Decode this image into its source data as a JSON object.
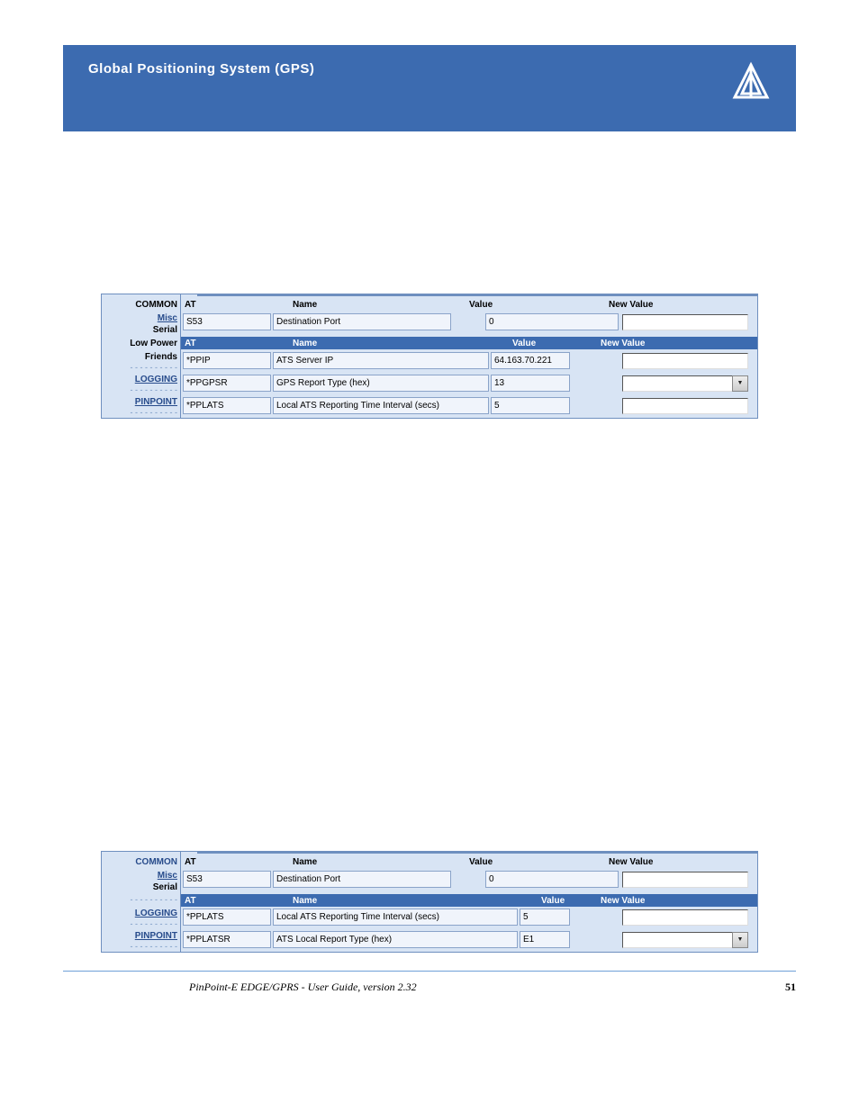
{
  "header": {
    "title": "Global Positioning System (GPS)"
  },
  "figure1": {
    "sidebar": {
      "common": "COMMON",
      "misc": "Misc",
      "serial": "Serial",
      "lowpower": "Low Power",
      "friends": "Friends",
      "logging": "LOGGING",
      "pinpoint": "PINPOINT"
    },
    "header1": {
      "at": "AT",
      "name": "Name",
      "value": "Value",
      "newvalue": "New Value"
    },
    "row1": {
      "at": "S53",
      "name": "Destination Port",
      "value": "0"
    },
    "header2": {
      "at": "AT",
      "name": "Name",
      "value": "Value",
      "newvalue": "New Value"
    },
    "row2": {
      "at": "*PPIP",
      "name": "ATS Server IP",
      "value": "64.163.70.221"
    },
    "row3": {
      "at": "*PPGPSR",
      "name": "GPS Report Type (hex)",
      "value": "13"
    },
    "row4": {
      "at": "*PPLATS",
      "name": "Local ATS Reporting Time Interval (secs)",
      "value": "5"
    }
  },
  "figure2": {
    "sidebar": {
      "common": "COMMON",
      "misc": "Misc",
      "serial": "Serial",
      "logging": "LOGGING",
      "pinpoint": "PINPOINT"
    },
    "header1": {
      "at": "AT",
      "name": "Name",
      "value": "Value",
      "newvalue": "New Value"
    },
    "row1": {
      "at": "S53",
      "name": "Destination Port",
      "value": "0"
    },
    "header2": {
      "at": "AT",
      "name": "Name",
      "value": "Value",
      "newvalue": "New Value"
    },
    "row2": {
      "at": "*PPLATS",
      "name": "Local ATS Reporting Time Interval (secs)",
      "value": "5"
    },
    "row3": {
      "at": "*PPLATSR",
      "name": "ATS Local Report Type (hex)",
      "value": "E1"
    }
  },
  "footer": {
    "title": "PinPoint-E EDGE/GPRS - User Guide, version 2.32",
    "page": "51"
  },
  "dashes": "- - - - - - - - - -"
}
